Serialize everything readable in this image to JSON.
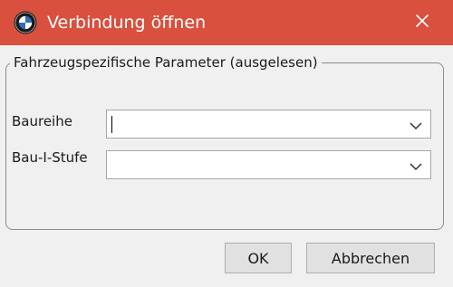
{
  "window": {
    "title": "Verbindung öffnen",
    "app_icon": "bmw-logo-icon",
    "close_icon": "close-icon",
    "titlebar_color": "#d9503e"
  },
  "group": {
    "legend": "Fahrzeugspezifische Parameter (ausgelesen)"
  },
  "fields": {
    "baureihe": {
      "label": "Baureihe",
      "value": "",
      "icon": "chevron-down-icon"
    },
    "bau_i_stufe": {
      "label": "Bau-I-Stufe",
      "value": "",
      "icon": "chevron-down-icon"
    }
  },
  "buttons": {
    "ok_label": "OK",
    "cancel_label": "Abbrechen"
  }
}
